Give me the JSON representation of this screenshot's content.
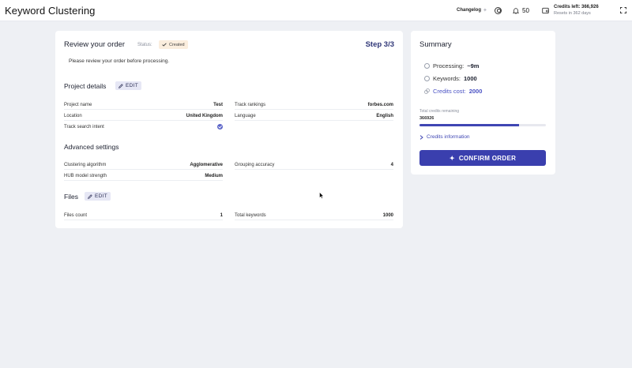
{
  "header": {
    "title": "Keyword Clustering",
    "changelog_label": "Changelog",
    "notification_count": "50",
    "credits_left": "Credits left: 366,926",
    "resets": "Resets in 362 days"
  },
  "order": {
    "title": "Review your order",
    "status_label": "Status:",
    "status_value": "Created",
    "step": "Step 3/3",
    "intro": "Please review your order before processing.",
    "edit_label": "EDIT",
    "project_details": {
      "title": "Project details",
      "rows": [
        {
          "key": "Project name",
          "value": "Test"
        },
        {
          "key": "Track rankings",
          "value": "forbes.com"
        },
        {
          "key": "Location",
          "value": "United Kingdom"
        },
        {
          "key": "Language",
          "value": "English"
        },
        {
          "key": "Track search intent",
          "checked": true
        }
      ]
    },
    "advanced_settings": {
      "title": "Advanced settings",
      "rows": [
        {
          "key": "Clustering algorithm",
          "value": "Agglomerative"
        },
        {
          "key": "Grouping accuracy",
          "value": "4"
        },
        {
          "key": "HUB model strength",
          "value": "Medium"
        }
      ]
    },
    "files": {
      "title": "Files",
      "rows": [
        {
          "key": "Files count",
          "value": "1"
        },
        {
          "key": "Total keywords",
          "value": "1000"
        }
      ]
    }
  },
  "summary": {
    "title": "Summary",
    "processing_label": "Processing:",
    "processing_value": "~9m",
    "keywords_label": "Keywords:",
    "keywords_value": "1000",
    "credits_cost_label": "Credits cost:",
    "credits_cost_value": "2000",
    "remaining_label": "Total credits remaining",
    "remaining_value": "366926",
    "remaining_progress": 0.79,
    "credits_info_label": "Credits information",
    "confirm_label": "CONFIRM ORDER"
  },
  "colors": {
    "accent": "#3a3fae",
    "status_bg": "#fbeede",
    "page_bg": "#eef0f4"
  },
  "icons": [
    "sparkle-icon",
    "user-circle-icon",
    "bell-icon",
    "wallet-icon",
    "expand-icon",
    "check-icon",
    "pencil-icon",
    "clock-icon",
    "keyword-icon",
    "coins-icon",
    "chevron-right-icon",
    "star-icon",
    "cursor-icon"
  ]
}
